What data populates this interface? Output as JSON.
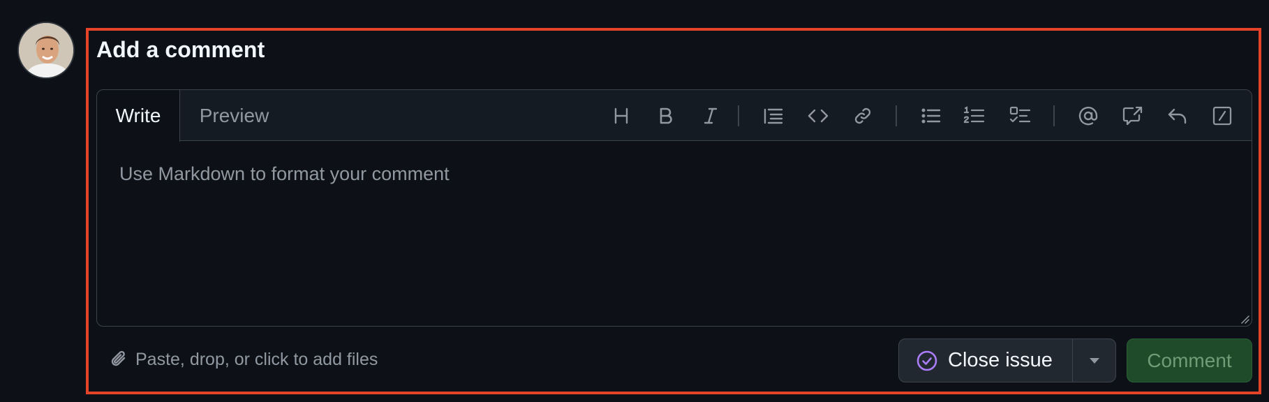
{
  "heading": "Add a comment",
  "tabs": {
    "write": "Write",
    "preview": "Preview"
  },
  "toolbar": {
    "icons": [
      "heading-icon",
      "bold-icon",
      "italic-icon",
      "quote-icon",
      "code-icon",
      "link-icon",
      "unordered-list-icon",
      "ordered-list-icon",
      "task-list-icon",
      "mention-icon",
      "reference-icon",
      "reply-icon",
      "slash-command-icon"
    ]
  },
  "editor": {
    "placeholder": "Use Markdown to format your comment"
  },
  "footer": {
    "attach_label": "Paste, drop, or click to add files",
    "close_issue_label": "Close issue",
    "comment_label": "Comment"
  },
  "colors": {
    "background": "#0d1117",
    "highlight": "#e5442b",
    "close_icon": "#ab7df8",
    "comment_button": "#1f4b2b"
  }
}
